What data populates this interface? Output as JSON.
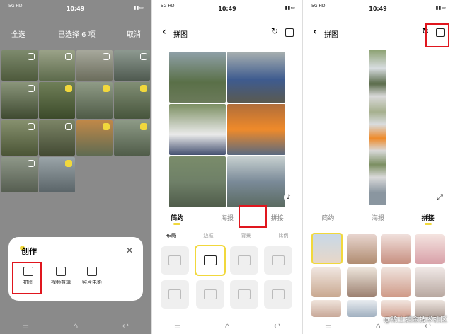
{
  "status": {
    "time": "10:49",
    "signal_left": "5G HD"
  },
  "panel1": {
    "select_all": "全选",
    "selected_count": "已选择 6 项",
    "cancel": "取消",
    "sheet_title": "创作",
    "actions": [
      {
        "label": "拼图",
        "icon": "collage-icon"
      },
      {
        "label": "视频剪辑",
        "icon": "video-edit-icon"
      },
      {
        "label": "照片电影",
        "icon": "photo-movie-icon"
      }
    ]
  },
  "panel2": {
    "title": "拼图",
    "tabs": [
      "简约",
      "海报",
      "拼接"
    ],
    "active_tab": "简约",
    "subtabs": [
      "布局",
      "边框",
      "背景",
      "比例"
    ],
    "active_subtab": "布局"
  },
  "panel3": {
    "title": "拼图",
    "tabs": [
      "简约",
      "海报",
      "拼接"
    ],
    "active_tab": "拼接"
  },
  "watermark": "@稀土掘金技术社区",
  "colors": {
    "accent": "#f1d83c",
    "highlight": "#e0161e"
  }
}
